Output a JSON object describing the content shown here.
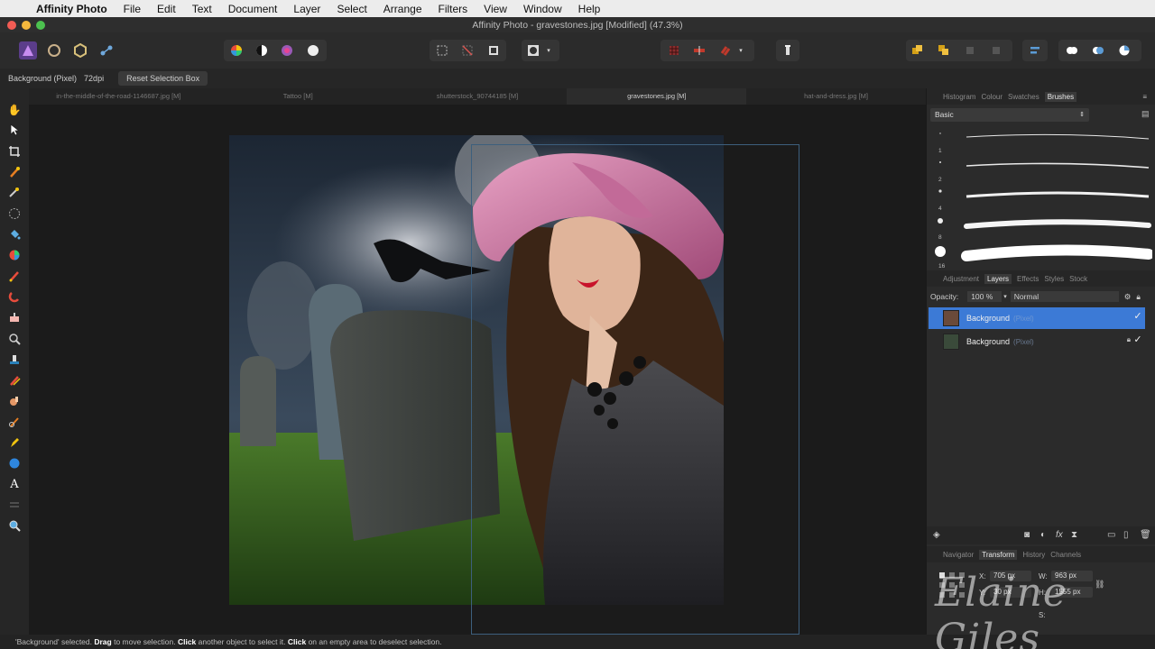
{
  "menubar": {
    "apple": "",
    "app_name": "Affinity Photo",
    "items": [
      "File",
      "Edit",
      "Text",
      "Document",
      "Layer",
      "Select",
      "Arrange",
      "Filters",
      "View",
      "Window",
      "Help"
    ]
  },
  "window": {
    "title": "Affinity Photo - gravestones.jpg [Modified] (47.3%)"
  },
  "context_bar": {
    "selection": "Background (Pixel)",
    "dpi": "72dpi",
    "reset_button": "Reset Selection Box"
  },
  "tabs": [
    {
      "label": "in-the-middle-of-the-road-1146687.jpg [M]",
      "active": false
    },
    {
      "label": "Tattoo [M]",
      "active": false
    },
    {
      "label": "shutterstock_90744185 [M]",
      "active": false
    },
    {
      "label": "gravestones.jpg [M]",
      "active": true
    },
    {
      "label": "hat-and-dress.jpg [M]",
      "active": false
    }
  ],
  "right_panel": {
    "top_tabs": [
      "Histogram",
      "Colour",
      "Swatches",
      "Brushes"
    ],
    "active_top_tab": "Brushes",
    "brush_category": "Basic",
    "brush_sizes": [
      "1",
      "2",
      "4",
      "8",
      "16"
    ],
    "mid_tabs": [
      "Adjustment",
      "Layers",
      "Effects",
      "Styles",
      "Stock"
    ],
    "active_mid_tab": "Layers",
    "opacity_label": "Opacity:",
    "opacity_value": "100 %",
    "blend_mode": "Normal",
    "layers": [
      {
        "name": "Background",
        "kind": "(Pixel)",
        "selected": true,
        "visible": true,
        "locked": false
      },
      {
        "name": "Background",
        "kind": "(Pixel)",
        "selected": false,
        "visible": true,
        "locked": true
      }
    ],
    "bottom_tabs": [
      "Navigator",
      "Transform",
      "History",
      "Channels"
    ],
    "active_bottom_tab": "Transform",
    "transform": {
      "x_label": "X:",
      "x_value": "705 px",
      "y_label": "Y:",
      "y_value": "30 px",
      "w_label": "W:",
      "w_value": "963 px",
      "h_label": "H:",
      "h_value": "1555 px",
      "s_label": "S:"
    }
  },
  "status_bar": {
    "parts": [
      {
        "text": "'Background' selected. ",
        "bold": false
      },
      {
        "text": "Drag",
        "bold": true
      },
      {
        "text": " to move selection. ",
        "bold": false
      },
      {
        "text": "Click",
        "bold": true
      },
      {
        "text": " another object to select it. ",
        "bold": false
      },
      {
        "text": "Click",
        "bold": true
      },
      {
        "text": " on an empty area to deselect selection.",
        "bold": false
      }
    ]
  },
  "watermark": "Elaine Giles",
  "icons": {
    "personas": [
      "photo-persona-icon",
      "liquify-persona-icon",
      "develop-persona-icon",
      "export-persona-icon"
    ],
    "left_tools": [
      "hand-icon",
      "move-icon",
      "crop-icon",
      "brush-selection-icon",
      "magic-wand-icon",
      "marquee-icon",
      "fill-icon",
      "color-picker-icon",
      "paint-brush-icon",
      "pixel-brush-icon",
      "clone-icon",
      "blemish-icon",
      "dodge-icon",
      "burn-icon",
      "smudge-icon",
      "sponge-icon",
      "ellipse-shape-icon",
      "text-icon",
      "slice-icon",
      "zoom-icon"
    ]
  },
  "colors": {
    "accent": "#3c7ad6",
    "panel": "#2b2b2b",
    "canvas": "#1b1b1b"
  }
}
